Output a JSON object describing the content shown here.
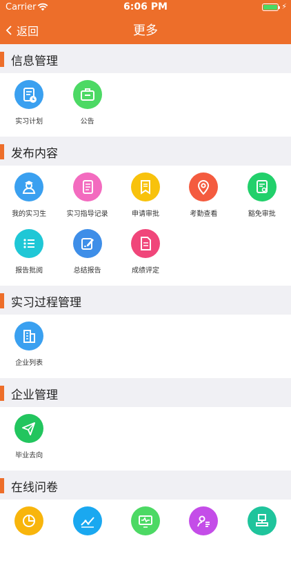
{
  "status": {
    "carrier": "Carrier",
    "time": "6:06 PM"
  },
  "nav": {
    "back_label": "返回",
    "title": "更多"
  },
  "colors": {
    "accent": "#ED6E2A",
    "section_bg": "#F0F0F4"
  },
  "sections": [
    {
      "title": "信息管理",
      "items": [
        {
          "label": "实习计划",
          "icon": "doc-clock-icon",
          "color": "#3AA0F0"
        },
        {
          "label": "公告",
          "icon": "briefcase-icon",
          "color": "#4CD964"
        }
      ]
    },
    {
      "title": "发布内容",
      "items": [
        {
          "label": "我的实习生",
          "icon": "student-icon",
          "color": "#3AA0F0"
        },
        {
          "label": "实习指导记录",
          "icon": "notes-icon",
          "color": "#F36BBF"
        },
        {
          "label": "申请审批",
          "icon": "bookmark-icon",
          "color": "#F8C20C"
        },
        {
          "label": "考勤查看",
          "icon": "location-pin-icon",
          "color": "#F45B3F"
        },
        {
          "label": "豁免审批",
          "icon": "certificate-icon",
          "color": "#22D06B"
        },
        {
          "label": "报告批阅",
          "icon": "list-icon",
          "color": "#1FC7D6"
        },
        {
          "label": "总结报告",
          "icon": "edit-icon",
          "color": "#3E8EE8"
        },
        {
          "label": "成绩评定",
          "icon": "document-icon",
          "color": "#F0467A"
        }
      ]
    },
    {
      "title": "实习过程管理",
      "items": [
        {
          "label": "企业列表",
          "icon": "building-icon",
          "color": "#3AA0F0"
        }
      ]
    },
    {
      "title": "企业管理",
      "items": [
        {
          "label": "毕业去向",
          "icon": "paper-plane-icon",
          "color": "#22C55E"
        }
      ]
    },
    {
      "title": "在线问卷",
      "items": [
        {
          "label": "",
          "icon": "pie-chart-icon",
          "color": "#F8B50C"
        },
        {
          "label": "",
          "icon": "trend-line-icon",
          "color": "#1AA8F0"
        },
        {
          "label": "",
          "icon": "monitor-pulse-icon",
          "color": "#4CD964"
        },
        {
          "label": "",
          "icon": "user-list-icon",
          "color": "#C44DE8"
        },
        {
          "label": "",
          "icon": "stamp-icon",
          "color": "#1FC49C"
        }
      ]
    }
  ]
}
